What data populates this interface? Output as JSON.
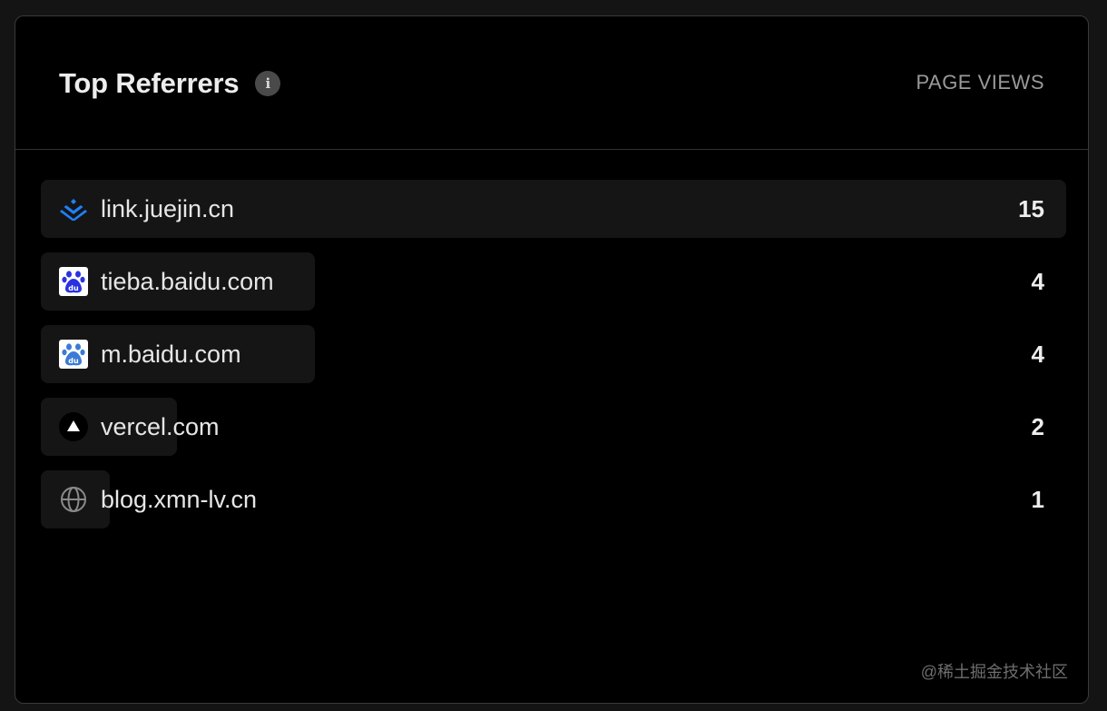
{
  "header": {
    "title": "Top Referrers",
    "info_icon": "info-icon",
    "column_label": "PAGE VIEWS"
  },
  "referrers": [
    {
      "domain": "link.juejin.cn",
      "views": "15",
      "icon": "juejin-icon",
      "share": 1.0
    },
    {
      "domain": "tieba.baidu.com",
      "views": "4",
      "icon": "baidu-icon",
      "share": 0.267
    },
    {
      "domain": "m.baidu.com",
      "views": "4",
      "icon": "baidu-icon",
      "share": 0.267
    },
    {
      "domain": "vercel.com",
      "views": "2",
      "icon": "vercel-icon",
      "share": 0.133
    },
    {
      "domain": "blog.xmn-lv.cn",
      "views": "1",
      "icon": "globe-icon",
      "share": 0.067
    }
  ],
  "watermark": "@稀土掘金技术社区",
  "colors": {
    "background": "#000000",
    "bar": "#151515",
    "juejin": "#1e80ff",
    "baidu": "#2932e1"
  }
}
